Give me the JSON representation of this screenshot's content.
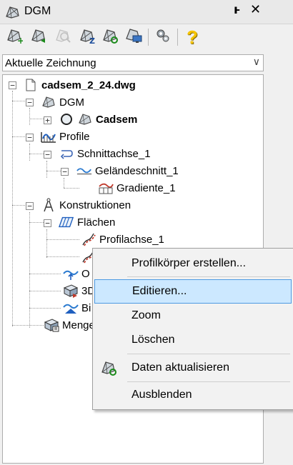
{
  "window": {
    "title": "DGM",
    "pin_glyph": "ͱ",
    "close_glyph": "✕"
  },
  "toolbar": {
    "buttons": [
      {
        "icon": "dgm-create-icon"
      },
      {
        "icon": "dgm-import-icon"
      },
      {
        "icon": "dgm-search-icon"
      },
      {
        "icon": "dgm-z-icon"
      },
      {
        "icon": "dgm-refresh-icon"
      },
      {
        "icon": "dgm-display-icon"
      },
      {
        "icon": "tools-icon"
      },
      {
        "icon": "help-icon"
      }
    ],
    "help_glyph": "?"
  },
  "scope_select": {
    "value": "Aktuelle Zeichnung"
  },
  "tree": {
    "root": "cadsem_2_24.dwg",
    "dgm": "DGM",
    "cadsem": "Cadsem",
    "profile": "Profile",
    "schnittachse": "Schnittachse_1",
    "gelaendeschnitt": "Geländeschnitt_1",
    "gradiente": "Gradiente_1",
    "konstruktionen": "Konstruktionen",
    "flaechen": "Flächen",
    "profilachse": "Profilachse_1",
    "item_o": "O",
    "item_3d": "3D",
    "item_bi": "Bi",
    "mengen": "Menge"
  },
  "context_menu": {
    "items": [
      {
        "label": "Profilkörper erstellen..."
      },
      {
        "label": "Editieren..."
      },
      {
        "label": "Zoom"
      },
      {
        "label": "Löschen"
      },
      {
        "label": "Daten aktualisieren"
      },
      {
        "label": "Ausblenden"
      }
    ]
  },
  "colors": {
    "accent": "#cce8ff",
    "accent_border": "#4d9ae2",
    "profile_red": "#c0392b",
    "help_yellow": "#f5c400"
  }
}
